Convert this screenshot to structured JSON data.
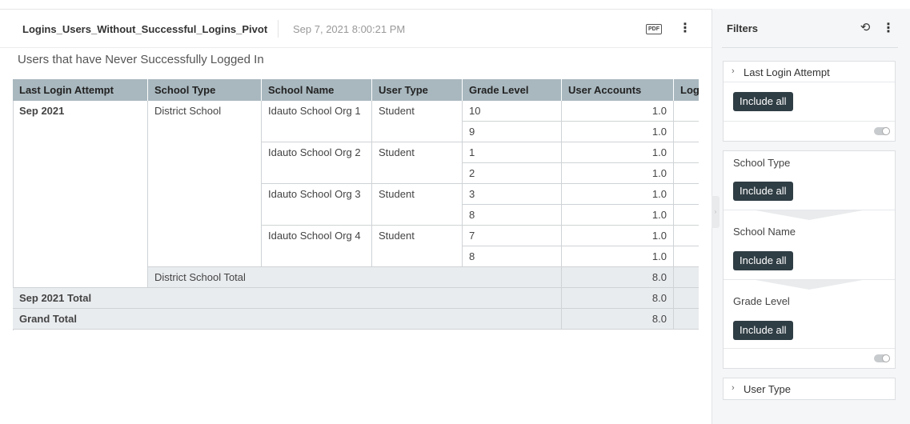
{
  "report": {
    "title": "Logins_Users_Without_Successful_Logins_Pivot",
    "timestamp": "Sep 7, 2021 8:00:21 PM",
    "pdf_label": "PDF",
    "more_label": "⋮",
    "subtitle": "Users that have Never Successfully Logged In"
  },
  "table": {
    "headers": [
      "Last Login Attempt",
      "School Type",
      "School Name",
      "User Type",
      "Grade Level",
      "User Accounts",
      "Log"
    ],
    "login_attempt": "Sep 2021",
    "school_type": "District School",
    "schools": [
      {
        "name": "Idauto School Org 1",
        "user_type": "Student",
        "rows": [
          {
            "grade": "10",
            "accounts": "1.0"
          },
          {
            "grade": "9",
            "accounts": "1.0"
          }
        ]
      },
      {
        "name": "Idauto School Org 2",
        "user_type": "Student",
        "rows": [
          {
            "grade": "1",
            "accounts": "1.0"
          },
          {
            "grade": "2",
            "accounts": "1.0"
          }
        ]
      },
      {
        "name": "Idauto School Org 3",
        "user_type": "Student",
        "rows": [
          {
            "grade": "3",
            "accounts": "1.0"
          },
          {
            "grade": "8",
            "accounts": "1.0"
          }
        ]
      },
      {
        "name": "Idauto School Org 4",
        "user_type": "Student",
        "rows": [
          {
            "grade": "7",
            "accounts": "1.0"
          },
          {
            "grade": "8",
            "accounts": "1.0"
          }
        ]
      }
    ],
    "school_type_total": {
      "label": "District School Total",
      "value": "8.0"
    },
    "month_total": {
      "label": "Sep 2021 Total",
      "value": "8.0"
    },
    "grand_total": {
      "label": "Grand Total",
      "value": "8.0"
    }
  },
  "filters": {
    "title": "Filters",
    "refresh_icon": "⟲",
    "more_label": "⋮",
    "include_all": "Include all",
    "last_login_attempt": "Last Login Attempt",
    "school_type": "School Type",
    "school_name": "School Name",
    "grade_level": "Grade Level",
    "user_type": "User Type"
  }
}
